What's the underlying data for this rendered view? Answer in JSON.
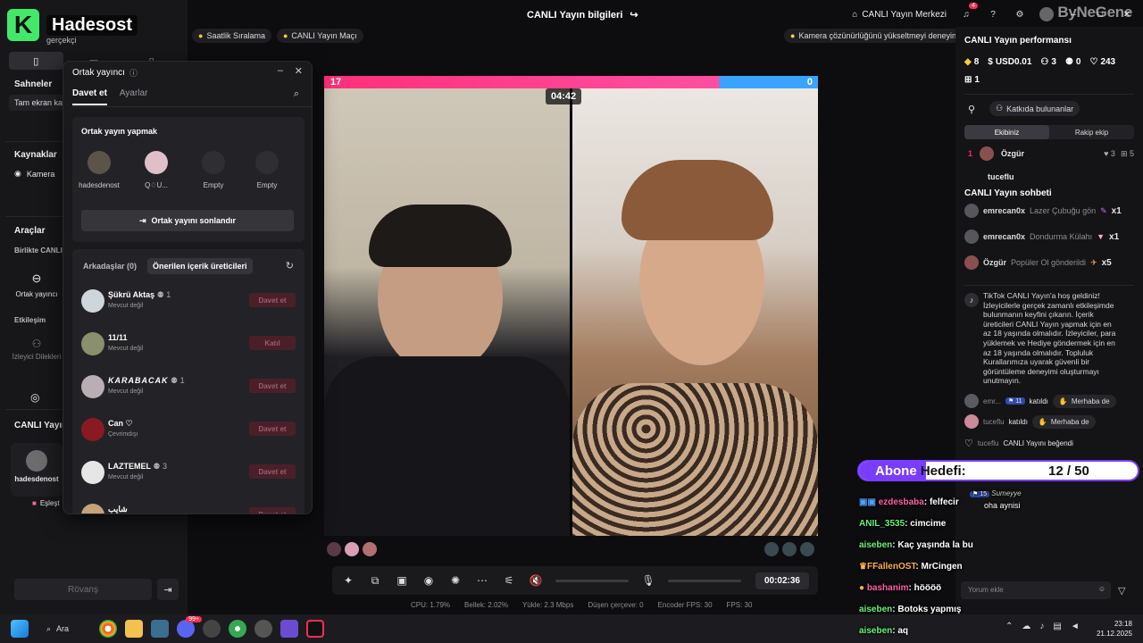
{
  "brand": {
    "logo_letter": "K",
    "name": "Hadesost"
  },
  "topbar": {
    "title": "CANLI Yayın bilgileri",
    "live_center": "CANLI Yayın Merkezi",
    "notif_count": "4",
    "watermark": "ByNeGene"
  },
  "sidebar": {
    "partial_title": "gerçekçi",
    "scenes_label": "Sahneler",
    "scene_item": "Tam ekran kamera",
    "sources_label": "Kaynaklar",
    "source_camera": "Kamera",
    "tools_label": "Araçlar",
    "together_label": "Birlikte CANLI",
    "cohost_label": "Ortak yayıncı",
    "interaction_label": "Etkileşim",
    "viewer_wishes": "İzleyici Dilekleri",
    "live_section": "CANLI Yayın",
    "live_user": "hadesdenost",
    "match_label": "Eşleşt",
    "rematch": "Rövanş"
  },
  "pills": {
    "hourly_ranking": "Saatlik Sıralama",
    "live_match": "CANLI Yayın Maçı",
    "camera_tip": "Kamera çözünürlüğünü yükseltmeyi deneyin"
  },
  "cohost": {
    "title": "Ortak yayıncı",
    "tab_invite": "Davet et",
    "tab_settings": "Ayarlar",
    "section_title": "Ortak yayın yapmak",
    "slots": [
      {
        "name": "hadesdenost"
      },
      {
        "name": "Q♢U..."
      },
      {
        "name": "Empty"
      },
      {
        "name": "Empty"
      }
    ],
    "end_button": "Ortak yayını sonlandır",
    "friends_tab": "Arkadaşlar (0)",
    "suggested_tab": "Önerilen içerik üreticileri",
    "creators": [
      {
        "name": "Şükrü Aktaş",
        "count": "1",
        "status": "Mevcut değil",
        "action": "Davet et"
      },
      {
        "name": "11/11",
        "count": "",
        "status": "Mevcut değil",
        "action": "Katıl"
      },
      {
        "name": "KARABACAK",
        "count": "1",
        "status": "Mevcut değil",
        "action": "Davet et"
      },
      {
        "name": "Can",
        "count": "",
        "status": "Çevrimdışı",
        "action": "Davet et"
      },
      {
        "name": "LAZTEMEL",
        "count": "3",
        "status": "Mevcut değil",
        "action": "Davet et"
      },
      {
        "name": "شايب",
        "count": "",
        "status": "",
        "action": "Davet et"
      }
    ]
  },
  "video": {
    "score_left": "17",
    "score_right": "0",
    "timer": "04:42",
    "stream_time": "00:02:36"
  },
  "stats": {
    "cpu": "CPU: 1.79%",
    "memory": "Bellek: 2.02%",
    "upload": "Yükle: 2.3 Mbps",
    "dropped": "Düşen çerçeve: 0",
    "encoder_fps": "Encoder FPS: 30",
    "fps": "FPS: 30"
  },
  "performance": {
    "title": "CANLI Yayın performansı",
    "coins": "8",
    "usd": "USD0.01",
    "viewers": "3",
    "new_followers": "0",
    "likes": "243",
    "gifts": "1",
    "contributors_btn": "Katkıda bulunanlar",
    "team_tab": "Ekibiniz",
    "rival_tab": "Rakip ekip",
    "rank_row": {
      "rank": "1",
      "name": "Özgür",
      "a": "3",
      "b": "5"
    },
    "rank_row2": "tuceflu"
  },
  "chat": {
    "title": "CANLI Yayın sohbeti",
    "gifts": [
      {
        "user": "emrecan0x",
        "gift": "Lazer Çubuğu gön",
        "mult": "x1"
      },
      {
        "user": "emrecan0x",
        "gift": "Dondurma Külahı",
        "mult": "x1"
      },
      {
        "user": "Özgür",
        "gift": "Popüler Ol gönderildi",
        "mult": "x5"
      }
    ],
    "welcome": "TikTok CANLI Yayın'a hoş geldiniz! İzleyicilerle gerçek zamanlı etkileşimde bulunmanın keyfini çıkarın. İçerik üreticileri CANLI Yayın yapmak için en az 18 yaşında olmalıdır. İzleyiciler, para yüklemek ve Hediye göndermek için en az 18 yaşında olmalıdır. Topluluk Kurallarımıza uyarak güvenli bir görüntüleme deneyimi oluşturmayı unutmayın.",
    "joins": [
      {
        "user": "emr...",
        "level": "11",
        "text": "katıldı",
        "action": "Merhaba de"
      },
      {
        "user": "tuceflu",
        "text": "katıldı",
        "action": "Merhaba de"
      }
    ],
    "liked": {
      "user": "tuceflu",
      "text": "CANLI Yayını beğendi"
    },
    "comment_placeholder": "Yorum ekle"
  },
  "overlay": {
    "goal_label_a": "Abone",
    "goal_label_b": "Hedefi:",
    "goal_count": "12 / 50",
    "goal_progress": 0.24,
    "lines": [
      {
        "user": "Sumeyye",
        "level": "15",
        "text": "oha aynisi"
      },
      {
        "user": "ezdesbaba",
        "text": "felfecir"
      },
      {
        "user": "ANIL_3535",
        "text": "cimcime"
      },
      {
        "user": "aiseben",
        "text": "Kaç yaşında la bu"
      },
      {
        "user": "FFallenOST",
        "text": "MrCingen"
      },
      {
        "user": "bashanim",
        "text": "höööö"
      },
      {
        "user": "aiseben",
        "text": "Botoks yapmış"
      },
      {
        "user": "aiseben",
        "text": "aq"
      }
    ]
  },
  "taskbar": {
    "search": "Ara",
    "time": "23:18",
    "date": "21.12.2025",
    "badge": "99+"
  },
  "colors": {
    "accent": "#fe2c55",
    "goal_purple": "#7a3cff",
    "brand_green": "#43e86b"
  }
}
